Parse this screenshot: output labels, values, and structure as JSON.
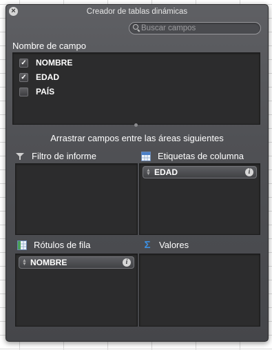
{
  "window": {
    "title": "Creador de tablas dinámicas"
  },
  "search": {
    "placeholder": "Buscar campos",
    "value": ""
  },
  "field_section": {
    "title": "Nombre de campo",
    "fields": [
      {
        "label": "NOMBRE",
        "checked": true
      },
      {
        "label": "EDAD",
        "checked": true
      },
      {
        "label": "PAÍS",
        "checked": false
      }
    ]
  },
  "hint": "Arrastrar campos entre las áreas siguientes",
  "areas": {
    "report_filter": {
      "title": "Filtro de informe",
      "icon": "filter-icon",
      "items": []
    },
    "column_labels": {
      "title": "Etiquetas de columna",
      "icon": "column-labels-icon",
      "items": [
        {
          "label": "EDAD"
        }
      ]
    },
    "row_labels": {
      "title": "Rótulos de fila",
      "icon": "row-labels-icon",
      "items": [
        {
          "label": "NOMBRE"
        }
      ]
    },
    "values": {
      "title": "Valores",
      "icon": "sigma-icon",
      "items": []
    }
  },
  "icons": {
    "close": "close-icon",
    "search": "search-icon",
    "info": "info-icon",
    "check": "checkmark-icon"
  },
  "colors": {
    "panel": "#505155",
    "well": "#2c2c2d",
    "text": "#ffffff",
    "sigma": "#3d8fe0"
  }
}
